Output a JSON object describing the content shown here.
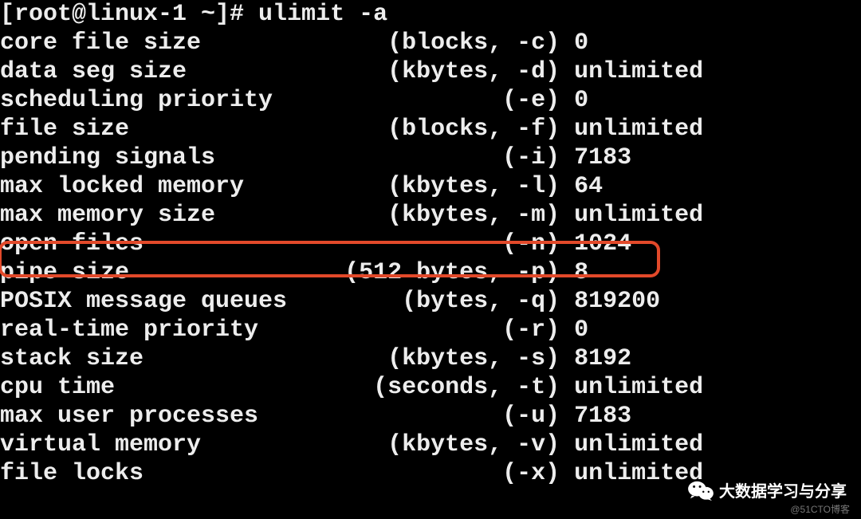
{
  "prompt": "[root@linux-1 ~]# ulimit -a",
  "rows": [
    {
      "label": "core file size",
      "unit": "(blocks, -c)",
      "value": "0"
    },
    {
      "label": "data seg size",
      "unit": "(kbytes, -d)",
      "value": "unlimited"
    },
    {
      "label": "scheduling priority",
      "unit": "(-e)",
      "value": "0"
    },
    {
      "label": "file size",
      "unit": "(blocks, -f)",
      "value": "unlimited"
    },
    {
      "label": "pending signals",
      "unit": "(-i)",
      "value": "7183"
    },
    {
      "label": "max locked memory",
      "unit": "(kbytes, -l)",
      "value": "64"
    },
    {
      "label": "max memory size",
      "unit": "(kbytes, -m)",
      "value": "unlimited"
    },
    {
      "label": "open files",
      "unit": "(-n)",
      "value": "1024",
      "highlight": true
    },
    {
      "label": "pipe size",
      "unit": "(512 bytes, -p)",
      "value": "8"
    },
    {
      "label": "POSIX message queues",
      "unit": "(bytes, -q)",
      "value": "819200"
    },
    {
      "label": "real-time priority",
      "unit": "(-r)",
      "value": "0"
    },
    {
      "label": "stack size",
      "unit": "(kbytes, -s)",
      "value": "8192"
    },
    {
      "label": "cpu time",
      "unit": "(seconds, -t)",
      "value": "unlimited"
    },
    {
      "label": "max user processes",
      "unit": "(-u)",
      "value": "7183"
    },
    {
      "label": "virtual memory",
      "unit": "(kbytes, -v)",
      "value": "unlimited"
    },
    {
      "label": "file locks",
      "unit": "(-x)",
      "value": "unlimited"
    }
  ],
  "watermark": {
    "icon": "wechat-icon",
    "text": "大数据学习与分享",
    "attrib": "@51CTO博客"
  },
  "layout": {
    "label_width": 24,
    "unit_width": 15
  }
}
